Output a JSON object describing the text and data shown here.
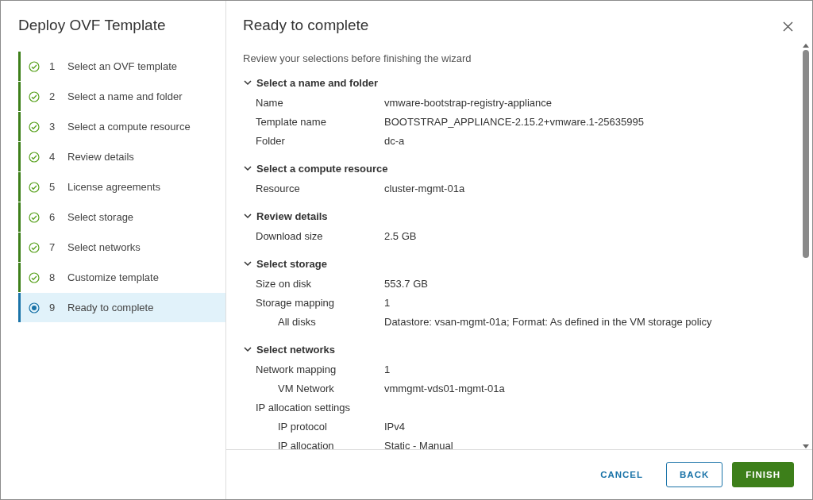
{
  "wizard": {
    "title": "Deploy OVF Template"
  },
  "steps": [
    {
      "number": "1",
      "label": "Select an OVF template",
      "completed": true,
      "selected": false
    },
    {
      "number": "2",
      "label": "Select a name and folder",
      "completed": true,
      "selected": false
    },
    {
      "number": "3",
      "label": "Select a compute resource",
      "completed": true,
      "selected": false
    },
    {
      "number": "4",
      "label": "Review details",
      "completed": true,
      "selected": false
    },
    {
      "number": "5",
      "label": "License agreements",
      "completed": true,
      "selected": false
    },
    {
      "number": "6",
      "label": "Select storage",
      "completed": true,
      "selected": false
    },
    {
      "number": "7",
      "label": "Select networks",
      "completed": true,
      "selected": false
    },
    {
      "number": "8",
      "label": "Customize template",
      "completed": true,
      "selected": false
    },
    {
      "number": "9",
      "label": "Ready to complete",
      "completed": false,
      "selected": true
    }
  ],
  "page": {
    "title": "Ready to complete",
    "subtitle": "Review your selections before finishing the wizard"
  },
  "sections": [
    {
      "title": "Select a name and folder",
      "expanded": true,
      "rows": [
        {
          "label": "Name",
          "value": "vmware-bootstrap-registry-appliance"
        },
        {
          "label": "Template name",
          "value": "BOOTSTRAP_APPLIANCE-2.15.2+vmware.1-25635995"
        },
        {
          "label": "Folder",
          "value": "dc-a"
        }
      ]
    },
    {
      "title": "Select a compute resource",
      "expanded": true,
      "rows": [
        {
          "label": "Resource",
          "value": "cluster-mgmt-01a"
        }
      ]
    },
    {
      "title": "Review details",
      "expanded": true,
      "rows": [
        {
          "label": "Download size",
          "value": "2.5 GB"
        }
      ]
    },
    {
      "title": "Select storage",
      "expanded": true,
      "rows": [
        {
          "label": "Size on disk",
          "value": "553.7 GB"
        },
        {
          "label": "Storage mapping",
          "value": "1",
          "children": [
            {
              "label": "All disks",
              "value": "Datastore: vsan-mgmt-01a; Format: As defined in the VM storage policy"
            }
          ]
        }
      ]
    },
    {
      "title": "Select networks",
      "expanded": true,
      "rows": [
        {
          "label": "Network mapping",
          "value": "1",
          "children": [
            {
              "label": "VM Network",
              "value": "vmmgmt-vds01-mgmt-01a"
            }
          ]
        },
        {
          "label": "IP allocation settings",
          "children": [
            {
              "label": "IP protocol",
              "value": "IPv4"
            },
            {
              "label": "IP allocation",
              "value": "Static - Manual"
            }
          ]
        }
      ]
    }
  ],
  "buttons": [
    {
      "label": "CANCEL",
      "kind": "flat"
    },
    {
      "label": "BACK",
      "kind": "outline"
    },
    {
      "label": "FINISH",
      "kind": "primary"
    }
  ]
}
